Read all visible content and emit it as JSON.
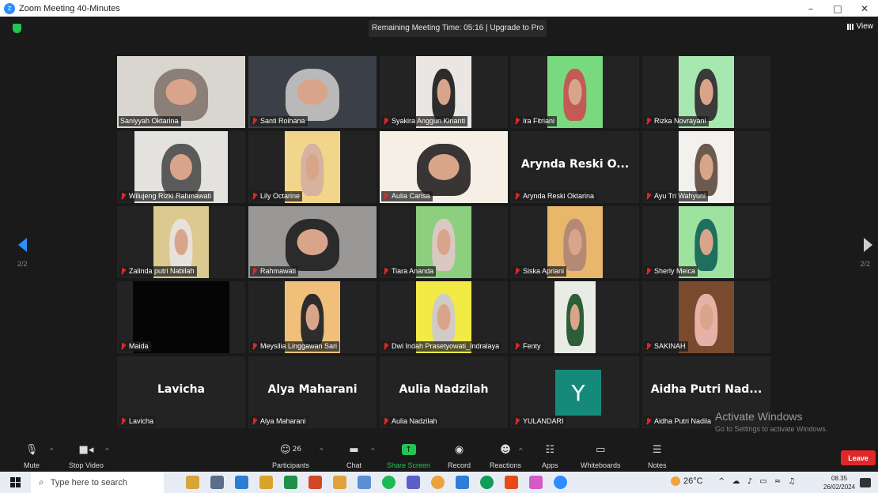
{
  "window": {
    "title": "Zoom Meeting 40-Minutes",
    "controls": [
      "–",
      "□",
      "✕"
    ]
  },
  "meeting": {
    "remaining_text": "Remaining Meeting Time: 05:16 | Upgrade to Pro",
    "view_label": "View",
    "page_left": "2/2",
    "page_right": "2/2"
  },
  "tiles": [
    {
      "name": "Saniyyah Oktarina",
      "kind": "video",
      "active": true,
      "muted": false,
      "bg": "#d9d6cf",
      "cloth": "#8b7f78",
      "vw": 162
    },
    {
      "name": "Santi Roihana",
      "kind": "video",
      "muted": true,
      "bg": "#3b4048",
      "cloth": "#b9b9b9",
      "vw": 162
    },
    {
      "name": "Syakira Anggun Kinanti",
      "kind": "video",
      "muted": true,
      "bg": "#e9e6e3",
      "cloth": "#2c2c2c",
      "vw": 70
    },
    {
      "name": "Ira Fitriani",
      "kind": "video",
      "muted": true,
      "bg": "#79d97f",
      "cloth": "#c45a55",
      "vw": 70
    },
    {
      "name": "Rizka Novrayani",
      "kind": "video",
      "muted": true,
      "bg": "#a7e8b0",
      "cloth": "#3a3a3a",
      "vw": 70
    },
    {
      "name": "Wilujeng Rizki Rahmawati",
      "kind": "video",
      "muted": true,
      "bg": "#e4e2de",
      "cloth": "#5a5a5a",
      "vw": 118
    },
    {
      "name": "Lily Octarine",
      "kind": "video",
      "muted": true,
      "bg": "#f1d58a",
      "cloth": "#d7b29f",
      "vw": 70
    },
    {
      "name": "Aulia Carisa",
      "kind": "video",
      "muted": true,
      "bg": "#f6efe6",
      "cloth": "#3a3535",
      "vw": 162
    },
    {
      "name": "Arynda Reski Oktarina",
      "kind": "name",
      "display": "Arynda Reski O...",
      "muted": true
    },
    {
      "name": "Ayu Tri Wahyuni",
      "kind": "video",
      "muted": true,
      "bg": "#f3f1ee",
      "cloth": "#6b5a4d",
      "vw": 70
    },
    {
      "name": "Zalinda putri Nabilah",
      "kind": "video",
      "muted": true,
      "bg": "#dcc98f",
      "cloth": "#e7e1dc",
      "vw": 70
    },
    {
      "name": "Rahmawati",
      "kind": "video",
      "muted": true,
      "bg": "#9a9896",
      "cloth": "#2b2b2b",
      "vw": 162
    },
    {
      "name": "Tiara Ananda",
      "kind": "video",
      "muted": true,
      "bg": "#8ccf7f",
      "cloth": "#d9c9c3",
      "vw": 70
    },
    {
      "name": "Siska Apriani",
      "kind": "video",
      "muted": true,
      "bg": "#e8b76c",
      "cloth": "#b58a74",
      "vw": 70
    },
    {
      "name": "Sherly Meica",
      "kind": "video",
      "muted": true,
      "bg": "#9de39f",
      "cloth": "#1f6e5e",
      "vw": 70
    },
    {
      "name": "Maida",
      "kind": "video",
      "muted": true,
      "bg": "#050505",
      "cloth": "#050505",
      "vw": 122
    },
    {
      "name": "Meysilia Linggawan Sari",
      "kind": "video",
      "muted": true,
      "bg": "#f0c07a",
      "cloth": "#2d2d2d",
      "vw": 70
    },
    {
      "name": "Dwi Indah Prasetyowati_Indralaya",
      "kind": "video",
      "muted": true,
      "bg": "#f2ea45",
      "cloth": "#d0cbc6",
      "vw": 70
    },
    {
      "name": "Fenty",
      "kind": "video",
      "muted": true,
      "bg": "#e9ece4",
      "cloth": "#2e5d3a",
      "vw": 52
    },
    {
      "name": "SAKINAH",
      "kind": "video",
      "muted": true,
      "bg": "#7a4a2e",
      "cloth": "#e8b1a8",
      "vw": 70
    },
    {
      "name": "Lavicha",
      "kind": "name",
      "display": "Lavicha",
      "muted": true
    },
    {
      "name": "Alya Maharani",
      "kind": "name",
      "display": "Alya Maharani",
      "muted": true
    },
    {
      "name": "Aulia Nadzilah",
      "kind": "name",
      "display": "Aulia Nadzilah",
      "muted": true
    },
    {
      "name": "YULANDARI",
      "kind": "avatar",
      "letter": "Y",
      "muted": true
    },
    {
      "name": "Aidha Putri Nadila",
      "kind": "name",
      "display": "Aidha Putri Nad...",
      "muted": true
    }
  ],
  "watermark": {
    "title": "Activate Windows",
    "subtitle": "Go to Settings to activate Windows."
  },
  "toolbar": {
    "mute": "Mute",
    "stop_video": "Stop Video",
    "participants": "Participants",
    "participants_count": "26",
    "chat": "Chat",
    "share_screen": "Share Screen",
    "record": "Record",
    "reactions": "Reactions",
    "apps": "Apps",
    "whiteboards": "Whiteboards",
    "notes": "Notes",
    "leave": "Leave"
  },
  "taskbar": {
    "search_placeholder": "Type here to search",
    "weather": "26°C",
    "time": "08.35",
    "date": "26/02/2024",
    "app_colors": [
      "#d9a43a",
      "#5a6f8a",
      "#2a7fd4",
      "#d9a42a",
      "#1f8f4a",
      "#d24726",
      "#e0a23a",
      "#5a8fd6",
      "#1db954",
      "#5b5fc7",
      "#e8a33c",
      "#2e7dd7",
      "#0f9d58",
      "#e64a19",
      "#d35ac7",
      "#2d8cff"
    ]
  }
}
